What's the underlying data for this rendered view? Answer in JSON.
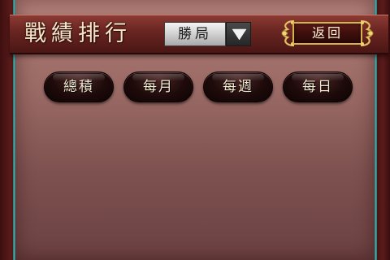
{
  "header": {
    "title": "戰績排行"
  },
  "filter": {
    "selected": "勝局",
    "arrow_icon": "triangle-down-icon"
  },
  "back_button": {
    "label": "返回",
    "ornament_icon": "golden-scroll-ornament"
  },
  "tabs": [
    {
      "label": "總積"
    },
    {
      "label": "每月"
    },
    {
      "label": "每週"
    },
    {
      "label": "每日"
    }
  ],
  "colors": {
    "panel_top": "#b98680",
    "panel_bottom": "#6b4142",
    "header_bar": "#6b2622",
    "teal_border": "#4fb3b0",
    "gold_trim": "#d8b24a",
    "title_text": "#f4e6c8"
  }
}
